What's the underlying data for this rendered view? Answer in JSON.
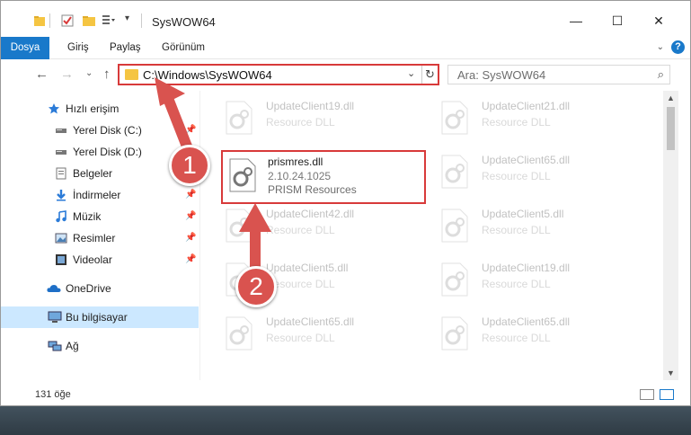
{
  "window": {
    "title": "SysWOW64",
    "controls": {
      "minimize": "—",
      "maximize": "☐",
      "close": "✕"
    }
  },
  "ribbon": {
    "tabs": [
      "Dosya",
      "Giriş",
      "Paylaş",
      "Görünüm"
    ]
  },
  "address": {
    "path": "C:\\Windows\\SysWOW64",
    "search_placeholder": "Ara: SysWOW64"
  },
  "sidebar": {
    "items": [
      {
        "label": "Hızlı erişim",
        "icon": "star-icon",
        "pinned": false
      },
      {
        "label": "Yerel Disk (C:)",
        "icon": "drive-icon",
        "pinned": true
      },
      {
        "label": "Yerel Disk (D:)",
        "icon": "drive-icon",
        "pinned": false
      },
      {
        "label": "Belgeler",
        "icon": "documents-icon",
        "pinned": true
      },
      {
        "label": "İndirmeler",
        "icon": "download-icon",
        "pinned": true
      },
      {
        "label": "Müzik",
        "icon": "music-icon",
        "pinned": true
      },
      {
        "label": "Resimler",
        "icon": "pictures-icon",
        "pinned": true
      },
      {
        "label": "Videolar",
        "icon": "videos-icon",
        "pinned": true
      },
      {
        "label": "OneDrive",
        "icon": "cloud-icon",
        "pinned": false
      },
      {
        "label": "Bu bilgisayar",
        "icon": "computer-icon",
        "pinned": false,
        "selected": true
      },
      {
        "label": "Ağ",
        "icon": "network-icon",
        "pinned": false
      }
    ]
  },
  "files": [
    {
      "name": "UpdateClient19.dll",
      "desc": "Resource DLL",
      "faded": true
    },
    {
      "name": "UpdateClient21.dll",
      "desc": "Resource DLL",
      "faded": true
    },
    {
      "name": "prismres.dll",
      "desc": "2.10.24.1025",
      "desc2": "PRISM Resources",
      "faded": false,
      "selected": true
    },
    {
      "name": "UpdateClient65.dll",
      "desc": "Resource DLL",
      "faded": true
    },
    {
      "name": "UpdateClient42.dll",
      "desc": "Resource DLL",
      "faded": true
    },
    {
      "name": "UpdateClient5.dll",
      "desc": "Resource DLL",
      "faded": true
    },
    {
      "name": "UpdateClient5.dll",
      "desc": "Resource DLL",
      "faded": true
    },
    {
      "name": "UpdateClient19.dll",
      "desc": "Resource DLL",
      "faded": true
    },
    {
      "name": "UpdateClient65.dll",
      "desc": "Resource DLL",
      "faded": true
    },
    {
      "name": "UpdateClient65.dll",
      "desc": "Resource DLL",
      "faded": true
    }
  ],
  "status": {
    "count": "131 öğe"
  },
  "callouts": [
    "1",
    "2"
  ],
  "colors": {
    "accent": "#1979ca",
    "highlight": "#d83a3a",
    "folder": "#f5c542"
  }
}
